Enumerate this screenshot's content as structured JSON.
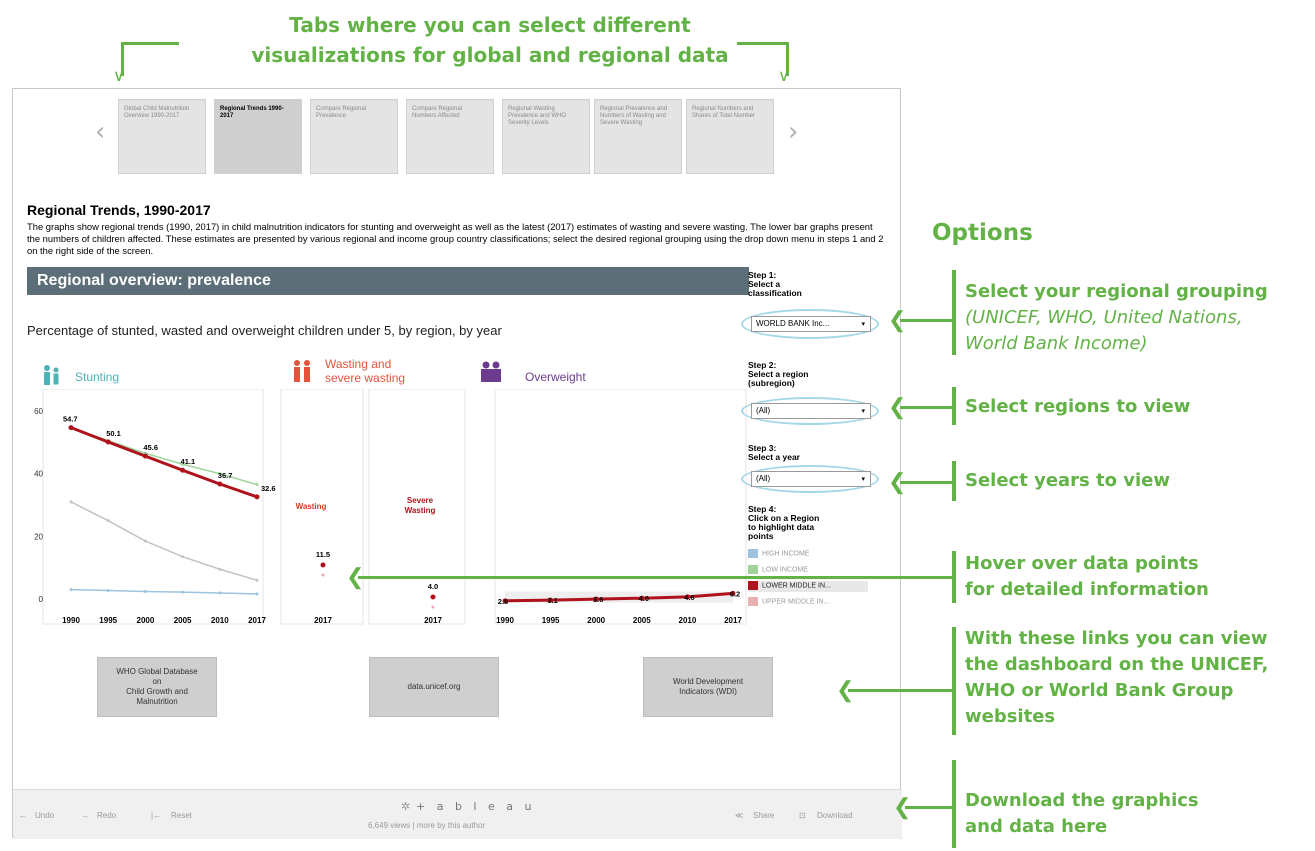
{
  "callouts": {
    "tabs_line1": "Tabs where you can select different",
    "tabs_line2": "visualizations for global and regional data",
    "options": "Options",
    "grouping_title": "Select your regional grouping",
    "grouping_sub1": "(UNICEF, WHO, United Nations,",
    "grouping_sub2": "World Bank Income)",
    "regions": "Select regions to view",
    "years": "Select years to view",
    "hover1": "Hover over data points",
    "hover2": "for detailed information",
    "links1": "With these links you can view",
    "links2": "the dashboard on the UNICEF,",
    "links3": "WHO or World Bank Group",
    "links4": "websites",
    "download1": "Download the graphics",
    "download2": "and data here"
  },
  "tabs": [
    "Global Child Malnutrition Overview 1990-2017",
    "Regional Trends 1990-2017",
    "Compare Regional Prevalence",
    "Compare Regional Numbers Affected",
    "Regional Wasting Prevalence and WHO Severity Levels",
    "Regional Prevalence and Numbers of Wasting and Severe Wasting",
    "Regional Numbers and Shares of Total Number"
  ],
  "nav": {
    "prev": "‹",
    "next": "›"
  },
  "page": {
    "title": "Regional Trends, 1990-2017",
    "description": "The graphs show regional trends (1990, 2017) in child malnutrition indicators for stunting and overweight as well as the latest (2017) estimates of wasting and severe wasting. The lower bar graphs present the numbers of children affected. These estimates are presented by various regional and income group country classifications; select the desired regional grouping using the drop down menu in steps 1 and 2 on the right side of the screen.",
    "banner": "Regional overview: prevalence",
    "subtitle": "Percentage of stunted, wasted and overweight children under 5, by region, by year"
  },
  "legend_groups": {
    "stunting": "Stunting",
    "wasting1": "Wasting and",
    "wasting2": "severe wasting",
    "overweight": "Overweight",
    "colors": {
      "stunting": "#4fb3b5",
      "wasting": "#e2553b",
      "overweight": "#6b3b8e"
    }
  },
  "chart_data": [
    {
      "type": "line",
      "panel": "Stunting",
      "x": [
        "1990",
        "1995",
        "2000",
        "2005",
        "2010",
        "2017"
      ],
      "ylim": [
        0,
        60
      ],
      "yticks": [
        "0",
        "20",
        "40",
        "60"
      ],
      "series": [
        {
          "name": "LOWER MIDDLE INCOME",
          "color": "#b0121b",
          "values": [
            54.7,
            50.1,
            45.6,
            41.1,
            36.7,
            32.6
          ],
          "labels": [
            "54.7",
            "50.1",
            "45.6",
            "41.1",
            "36.7",
            "32.6"
          ]
        },
        {
          "color": "#9fd39a",
          "values": [
            54.5,
            50.5,
            46.5,
            43.0,
            40.0,
            36.5
          ]
        },
        {
          "color": "#c8c0c0",
          "values": [
            31.0,
            25.0,
            18.5,
            13.5,
            9.5,
            6.0
          ]
        },
        {
          "color": "#9cc3e0",
          "values": [
            3.0,
            2.7,
            2.4,
            2.2,
            1.9,
            1.6
          ]
        }
      ]
    },
    {
      "type": "scatter",
      "panel": "Wasting",
      "label": "Wasting",
      "x": [
        "2017"
      ],
      "values": [
        11.5
      ],
      "value_label": "11.5"
    },
    {
      "type": "scatter",
      "panel": "Severe Wasting",
      "label1": "Severe",
      "label2": "Wasting",
      "x": [
        "2017"
      ],
      "values": [
        4.0
      ],
      "value_label": "4.0"
    },
    {
      "type": "line",
      "panel": "Overweight",
      "x": [
        "1990",
        "1995",
        "2000",
        "2005",
        "2010",
        "2017"
      ],
      "series": [
        {
          "name": "LOWER MIDDLE INCOME",
          "color": "#b0121b",
          "values": [
            2.8,
            3.1,
            3.6,
            4.0,
            4.6,
            6.2
          ],
          "labels": [
            "2.8",
            "3.1",
            "3.6",
            "4.0",
            "4.6",
            "6.2"
          ]
        }
      ]
    }
  ],
  "sidebar": {
    "step1_1": "Step 1:",
    "step1_2": "Select a",
    "step1_3": "classification",
    "classification": "WORLD BANK Inc...",
    "step2_1": "Step 2:",
    "step2_2": "Select a region",
    "step2_3": "(subregion)",
    "region": "(All)",
    "step3_1": "Step 3:",
    "step3_2": "Select a year",
    "year": "(All)",
    "step4_1": "Step 4:",
    "step4_2": "Click on a Region",
    "step4_3": "to highlight data",
    "step4_4": "points",
    "legend": [
      {
        "label": "HIGH INCOME",
        "color": "#9cc3e0"
      },
      {
        "label": "LOW INCOME",
        "color": "#9fd39a"
      },
      {
        "label": "LOWER MIDDLE IN...",
        "color": "#b0121b"
      },
      {
        "label": "UPPER MIDDLE IN...",
        "color": "#e8b0b0"
      }
    ],
    "arrow": "▾"
  },
  "links": {
    "who1": "WHO Global Database",
    "who2": "on",
    "who3": "Child Growth and",
    "who4": "Malnutrition",
    "unicef": "data.unicef.org",
    "wb1": "World Development",
    "wb2": "Indicators (WDI)"
  },
  "toolbar": {
    "undo": "Undo",
    "redo": "Redo",
    "reset": "Reset",
    "logo": "+ a b l e a u",
    "views": "6,649 views | more by this author",
    "share": "Share",
    "download": "Download"
  }
}
